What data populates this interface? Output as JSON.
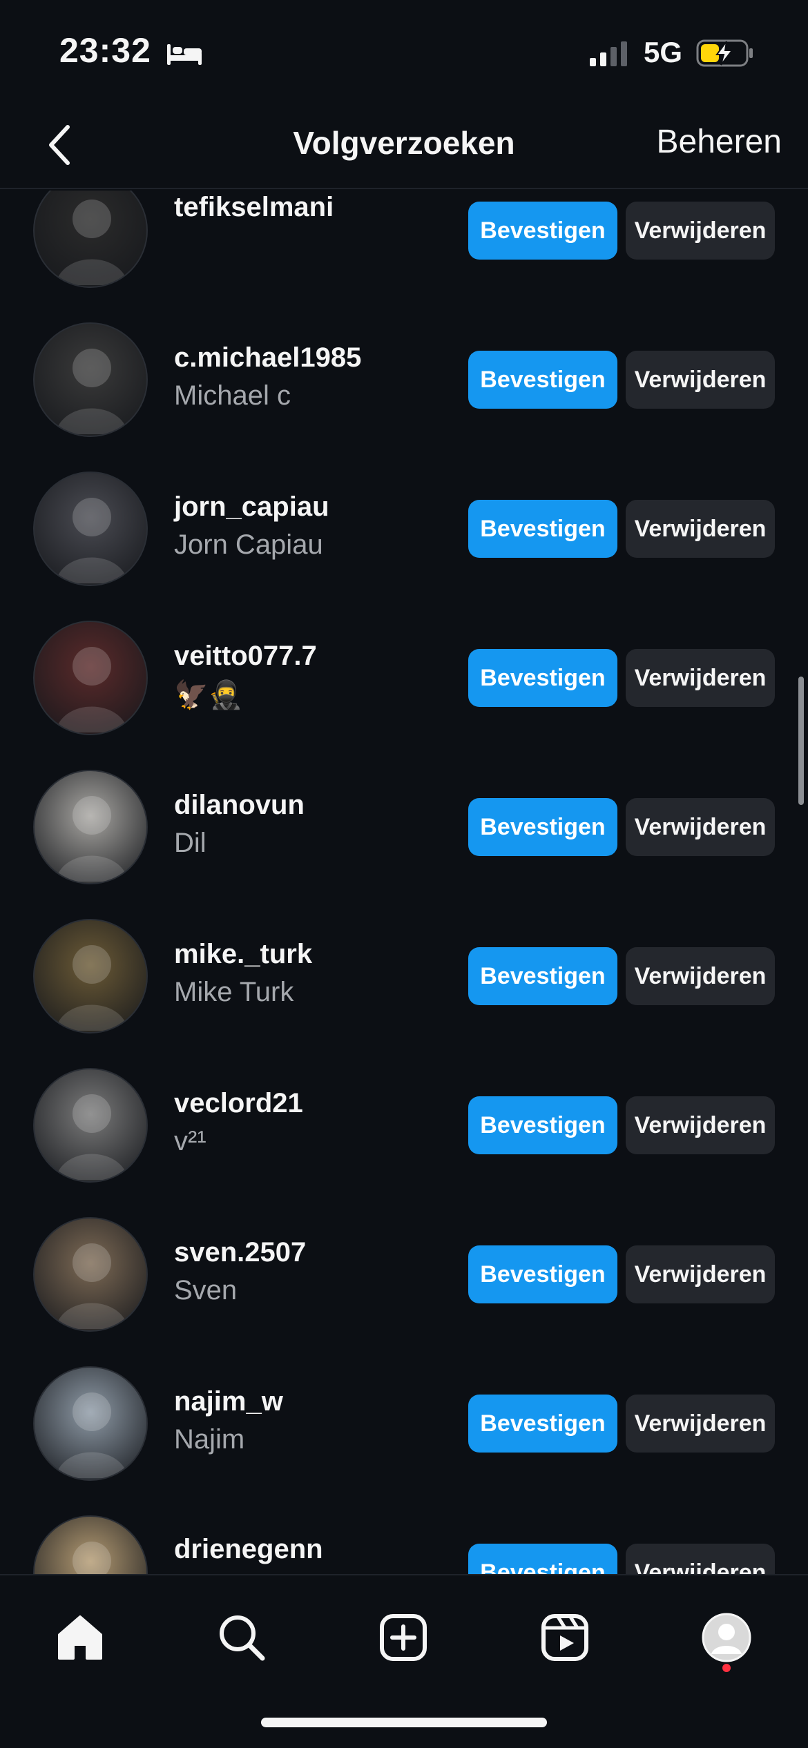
{
  "status_bar": {
    "time": "23:32",
    "focus_icon": "bed-icon",
    "network": "5G",
    "signal_icon": "cellular-signal-icon",
    "battery_icon": "battery-charging-icon"
  },
  "header": {
    "title": "Volgverzoeken",
    "manage_label": "Beheren",
    "back_icon": "chevron-left-icon"
  },
  "requests": [
    {
      "username": "tefikselmani",
      "fullname": "",
      "avatar_color": "#2b2b2b"
    },
    {
      "username": "c.michael1985",
      "fullname": "Michael c",
      "avatar_color": "#3a3a3a"
    },
    {
      "username": "jorn_capiau",
      "fullname": "Jorn Capiau",
      "avatar_color": "#4a4b52"
    },
    {
      "username": "veitto077.7",
      "fullname": "🦅🥷",
      "avatar_color": "#5a2a2a"
    },
    {
      "username": "dilanovun",
      "fullname": "Dil",
      "avatar_color": "#a8a6a2"
    },
    {
      "username": "mike._turk",
      "fullname": "Mike Turk",
      "avatar_color": "#6b5a36"
    },
    {
      "username": "veclord21",
      "fullname": "v²¹",
      "avatar_color": "#7a7a7a"
    },
    {
      "username": "sven.2507",
      "fullname": "Sven",
      "avatar_color": "#7d6a55"
    },
    {
      "username": "najim_w",
      "fullname": "Najim",
      "avatar_color": "#8e9aa6"
    },
    {
      "username": "drienegenn",
      "fullname": "",
      "avatar_color": "#b39a72"
    }
  ],
  "buttons": {
    "confirm_label": "Bevestigen",
    "delete_label": "Verwijderen"
  },
  "colors": {
    "background": "#0c0f14",
    "confirm": "#1597f0",
    "delete": "#24272d",
    "notification_dot": "#ff3040"
  },
  "tab_bar": {
    "tabs": [
      "home-icon",
      "search-icon",
      "create-icon",
      "reels-icon",
      "profile-avatar"
    ]
  }
}
